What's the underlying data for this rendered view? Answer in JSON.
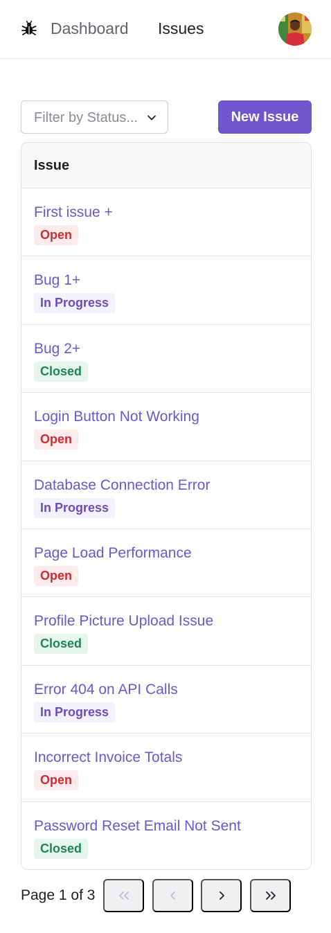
{
  "nav": {
    "logo_icon": "bug-icon",
    "links": [
      "Dashboard",
      "Issues"
    ],
    "active": "Issues",
    "avatar_icon": "user-avatar"
  },
  "toolbar": {
    "filter_placeholder": "Filter by Status...",
    "new_issue_label": "New Issue"
  },
  "table": {
    "header": "Issue",
    "rows": [
      {
        "title": "First issue +",
        "status": "Open"
      },
      {
        "title": "Bug 1+",
        "status": "In Progress"
      },
      {
        "title": "Bug 2+",
        "status": "Closed"
      },
      {
        "title": "Login Button Not Working",
        "status": "Open"
      },
      {
        "title": "Database Connection Error",
        "status": "In Progress"
      },
      {
        "title": "Page Load Performance",
        "status": "Open"
      },
      {
        "title": "Profile Picture Upload Issue",
        "status": "Closed"
      },
      {
        "title": "Error 404 on API Calls",
        "status": "In Progress"
      },
      {
        "title": "Incorrect Invoice Totals",
        "status": "Open"
      },
      {
        "title": "Password Reset Email Not Sent",
        "status": "Closed"
      }
    ]
  },
  "pagination": {
    "label": "Page 1 of 3",
    "buttons": [
      "first-page-icon",
      "previous-page-icon",
      "next-page-icon",
      "last-page-icon"
    ]
  },
  "colors": {
    "accent": "#6e56cf",
    "open": "#ce2c31",
    "in_progress": "#6550b9",
    "closed": "#218358"
  }
}
